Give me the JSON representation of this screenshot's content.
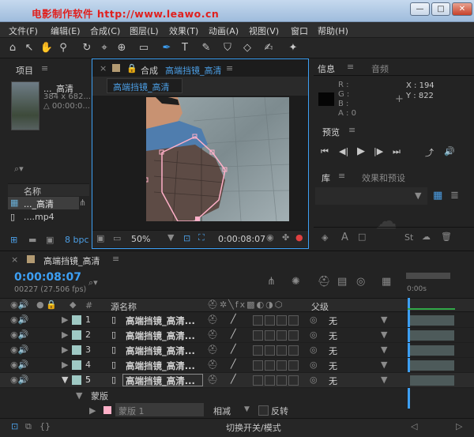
{
  "window": {
    "watermark": "电影制作软件   http://www.leawo.cn",
    "min": "—",
    "max": "□",
    "close": "✕"
  },
  "menu": [
    "文件(F)",
    "编辑(E)",
    "合成(C)",
    "图层(L)",
    "效果(T)",
    "动画(A)",
    "视图(V)",
    "窗口",
    "帮助(H)"
  ],
  "project": {
    "tab": "项目",
    "menu": "≡",
    "item_name": "..._高清",
    "item_size": "384 x 682...",
    "item_delta": "△ 00:00:0...",
    "search_icon": "⌕▾",
    "col_name": "名称",
    "items": [
      "..._高清",
      "....mp4"
    ],
    "bpc": "8 bpc"
  },
  "comp": {
    "close": "×",
    "tab": "合成",
    "tab_name": "高端挡镜_高清",
    "menu": "≡",
    "active_name": "高端挡镜_高清",
    "zoom": "50%",
    "timecode": "0:00:08:07"
  },
  "info": {
    "tab1": "信息",
    "tab2": "音频",
    "menu": "≡",
    "r": "R :",
    "g": "G :",
    "b": "B :",
    "a": "A : 0",
    "x": "X : 194",
    "y": "Y : 822"
  },
  "preview": {
    "tab": "预览",
    "menu": "≡"
  },
  "library": {
    "tab1": "库",
    "tab2": "效果和预设",
    "menu": "≡"
  },
  "timeline": {
    "close": "×",
    "name": "高端挡镜_高清",
    "menu": "≡",
    "timecode": "0:00:08:07",
    "frames": "00227 (27.506 fps)",
    "search_icon": "⌕▾",
    "ruler_label": "0:00s",
    "col_hash": "#",
    "col_source": "源名称",
    "col_parent": "父级",
    "toggle": "切换开关/模式"
  },
  "layers": [
    {
      "num": "1",
      "name": "高端挡镜_高清...",
      "parent": "无"
    },
    {
      "num": "2",
      "name": "高端挡镜_高清...",
      "parent": "无"
    },
    {
      "num": "3",
      "name": "高端挡镜_高清...",
      "parent": "无"
    },
    {
      "num": "4",
      "name": "高端挡镜_高清...",
      "parent": "无"
    },
    {
      "num": "5",
      "name": "高端挡镜_高清...",
      "parent": "无"
    }
  ],
  "mask": {
    "group": "蒙版",
    "name": "蒙版 1",
    "mode": "相减",
    "invert": "反转"
  },
  "colors": {
    "accent": "#3d9ff3",
    "swatch": "#9fc9c4",
    "mask": "#ffb0c8"
  }
}
